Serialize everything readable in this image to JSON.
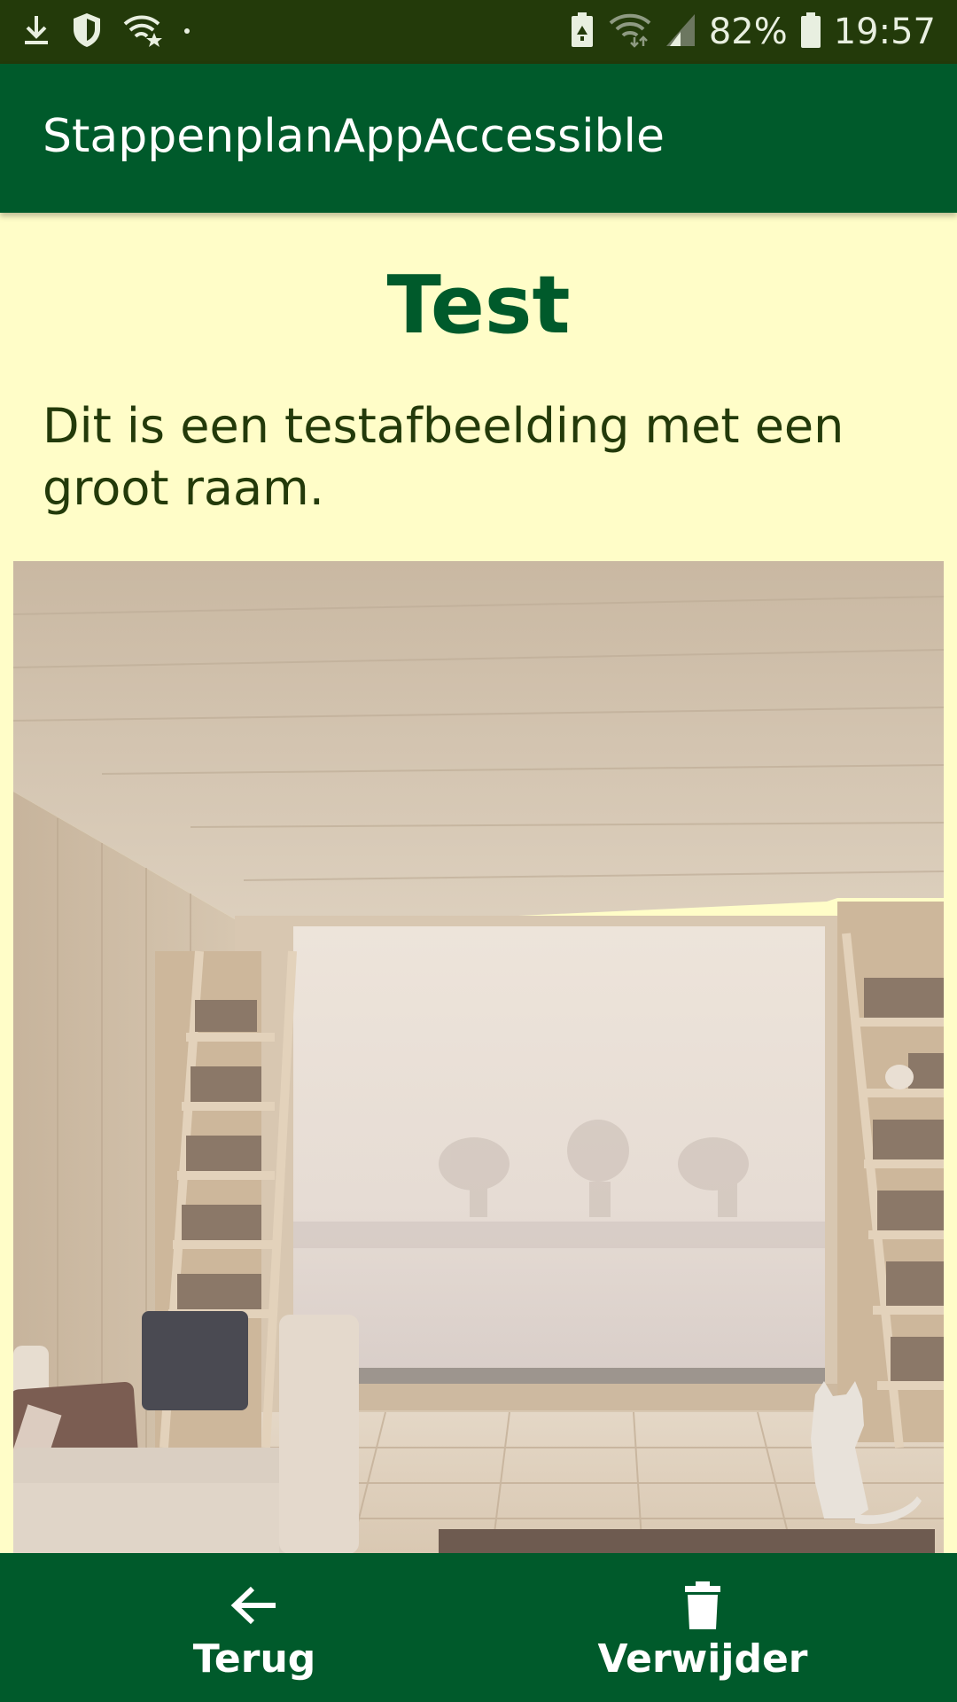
{
  "status_bar": {
    "battery_percent": "82%",
    "time": "19:57",
    "icons": [
      "download-icon",
      "shield-icon",
      "wifi-star-icon",
      "dot-icon",
      "battery-saver-icon",
      "wifi-icon",
      "signal-icon",
      "battery-icon"
    ]
  },
  "app_bar": {
    "title": "StappenplanAppAccessible"
  },
  "content": {
    "title": "Test",
    "description": "Dit is een testafbeelding met een groot raam."
  },
  "bottom_nav": {
    "back_label": "Terug",
    "back_icon": "arrow-left-icon",
    "delete_label": "Verwijder",
    "delete_icon": "trash-icon"
  },
  "colors": {
    "status_bar": "#233A0A",
    "app_bar": "#005A2B",
    "background": "#FFFDC8",
    "title": "#005A2B",
    "text": "#233A0A"
  }
}
